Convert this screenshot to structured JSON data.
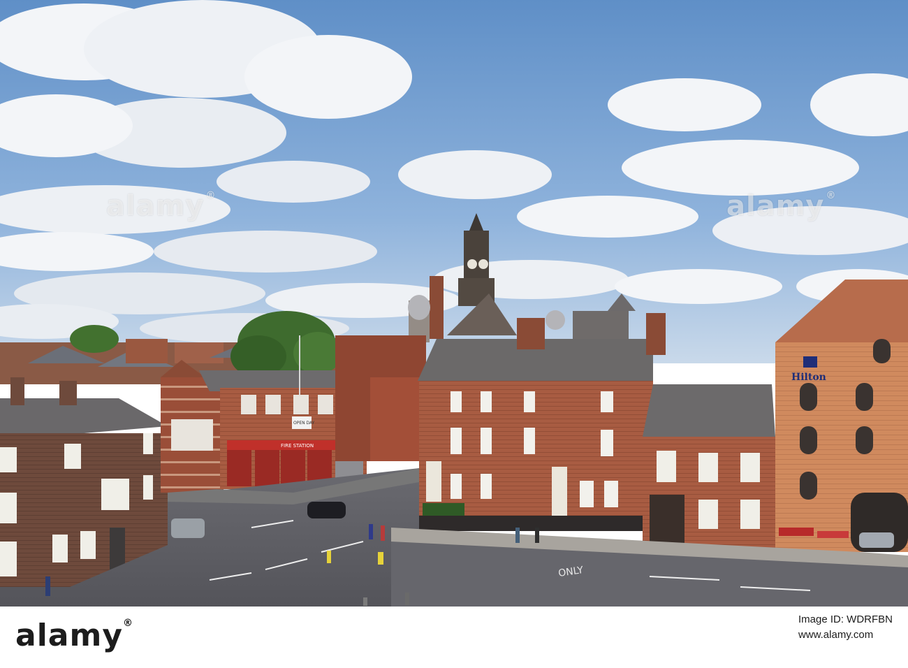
{
  "watermark": {
    "text": "alamy",
    "registered": "®"
  },
  "scene_text": {
    "fire_station_sign": "FIRE STATION",
    "open_day_sign": "OPEN DAY",
    "hotel_sign": "Hilton",
    "road_marking": "ONLY"
  },
  "footer": {
    "logo": "alamy",
    "logo_registered": "®",
    "image_id_label": "Image ID:",
    "image_id": "WDRFBN",
    "url": "www.alamy.com"
  },
  "colors": {
    "sky": "#6f9ccf",
    "brick": "#a4583f",
    "road": "#5d5d62"
  }
}
